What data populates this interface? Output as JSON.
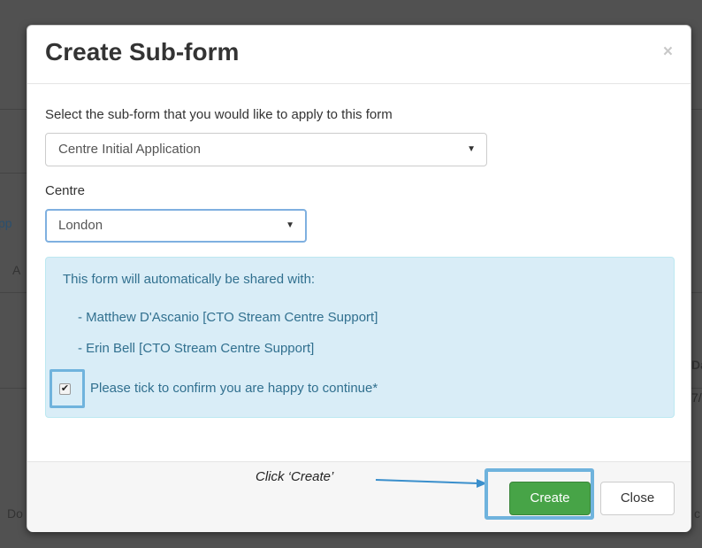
{
  "background": {
    "fragments": [
      "pp",
      "A",
      "Da",
      "7/",
      "Do",
      "c"
    ]
  },
  "modal": {
    "title": "Create Sub-form",
    "close_glyph": "×",
    "subform_label": "Select the sub-form that you would like to apply to this form",
    "subform_value": "Centre Initial Application",
    "centre_label": "Centre",
    "centre_value": "London",
    "caret_glyph": "▼",
    "info": {
      "intro": "This form will automatically be shared with:",
      "recipients": [
        "-   Matthew D'Ascanio [CTO Stream Centre Support]",
        "-   Erin Bell [CTO Stream Centre Support]"
      ],
      "confirm_label": "Please tick to confirm you are happy to continue*",
      "confirm_checked": true,
      "check_glyph": "✔"
    },
    "footer": {
      "annotation": "Click ‘Create’",
      "create_label": "Create",
      "close_label": "Close"
    }
  },
  "colors": {
    "create_button": "#47a447",
    "highlight": "#6fb3dd",
    "info_bg": "#d9edf7",
    "info_text": "#31708f"
  }
}
